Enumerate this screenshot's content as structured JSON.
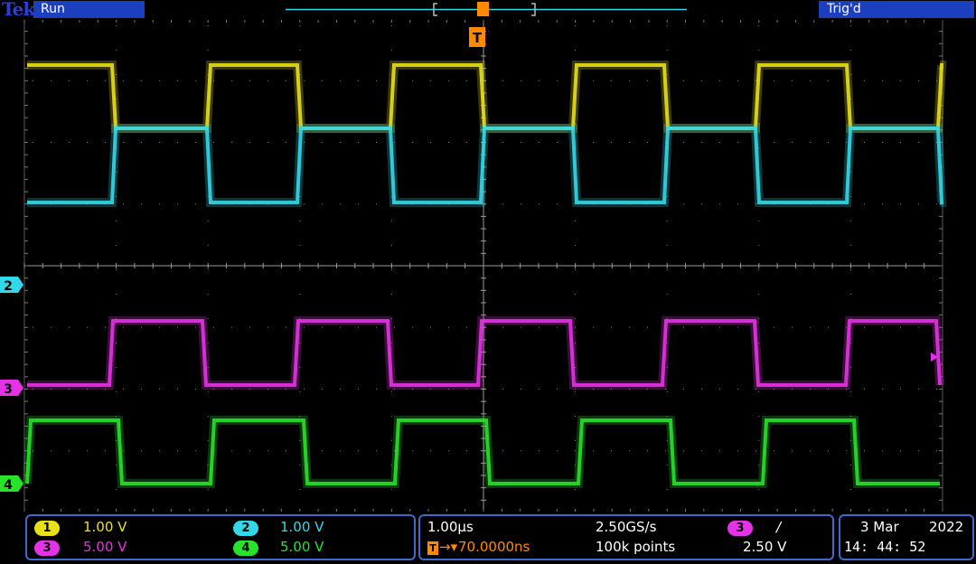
{
  "header": {
    "brand": "Tek",
    "status": "Run",
    "trigger_status": "Trig'd"
  },
  "markers": {
    "trigger_tag": "T",
    "ch2_tag": "2",
    "ch3_tag": "3",
    "ch4_tag": "4"
  },
  "channels": [
    {
      "number": "1",
      "scale": "1.00 V",
      "color": "#e8e019"
    },
    {
      "number": "2",
      "scale": "1.00 V",
      "color": "#33d8e8"
    },
    {
      "number": "3",
      "scale": "5.00 V",
      "color": "#e632e6"
    },
    {
      "number": "4",
      "scale": "5.00 V",
      "color": "#27e32a"
    }
  ],
  "timebase": {
    "scale": "1.00µs",
    "sample_rate": "2.50GS/s",
    "trigger_position": "70.0000ns",
    "record_length": "100k points"
  },
  "trigger": {
    "source": "3",
    "slope_symbol": "/",
    "level": "2.50 V"
  },
  "datetime": {
    "date": "3 Mar",
    "year": "2022",
    "time": "14: 44: 52"
  },
  "colors": {
    "accent": "#1c3fbf",
    "graticule": "#7a7a7a",
    "trigger_marker": "#ff8a00"
  }
}
